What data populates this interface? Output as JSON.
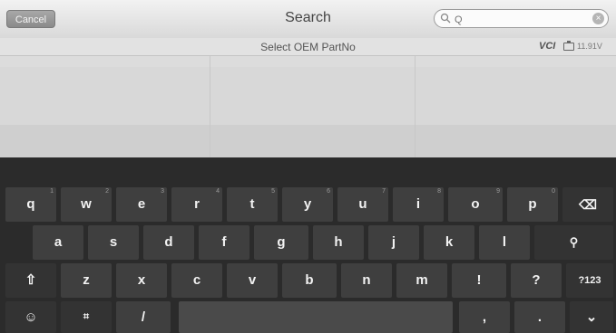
{
  "topbar": {
    "cancel_label": "Cancel",
    "title": "Search",
    "search_placeholder": "Q",
    "clear_icon": "×"
  },
  "subbar": {
    "title": "Select OEM PartNo",
    "vci_label": "VCI",
    "voltage": "11.91V"
  },
  "keyboard": {
    "row1": [
      {
        "label": "q",
        "hint": "1"
      },
      {
        "label": "w",
        "hint": "2"
      },
      {
        "label": "e",
        "hint": "3"
      },
      {
        "label": "r",
        "hint": "4"
      },
      {
        "label": "t",
        "hint": "5"
      },
      {
        "label": "y",
        "hint": "6"
      },
      {
        "label": "u",
        "hint": "7"
      },
      {
        "label": "i",
        "hint": "8"
      },
      {
        "label": "o",
        "hint": "9"
      },
      {
        "label": "p",
        "hint": "0"
      }
    ],
    "row2": [
      "a",
      "s",
      "d",
      "f",
      "g",
      "h",
      "j",
      "k",
      "l"
    ],
    "row3": [
      "z",
      "x",
      "c",
      "v",
      "b",
      "n",
      "m",
      "!",
      "?"
    ],
    "backspace_icon": "⌫",
    "search_key_icon": "⚲",
    "shift_icon": "⇧",
    "symbols_label": "?123",
    "emoji_icon": "☺",
    "lang_icon": "⌗",
    "slash_label": "/",
    "comma_label": ",",
    "period_label": ".",
    "hide_icon": "⌄"
  },
  "colors": {
    "keyboard_bg": "#2b2b2b",
    "key_bg": "#3f3f3f",
    "topbar_bg": "#e6e6e6"
  }
}
